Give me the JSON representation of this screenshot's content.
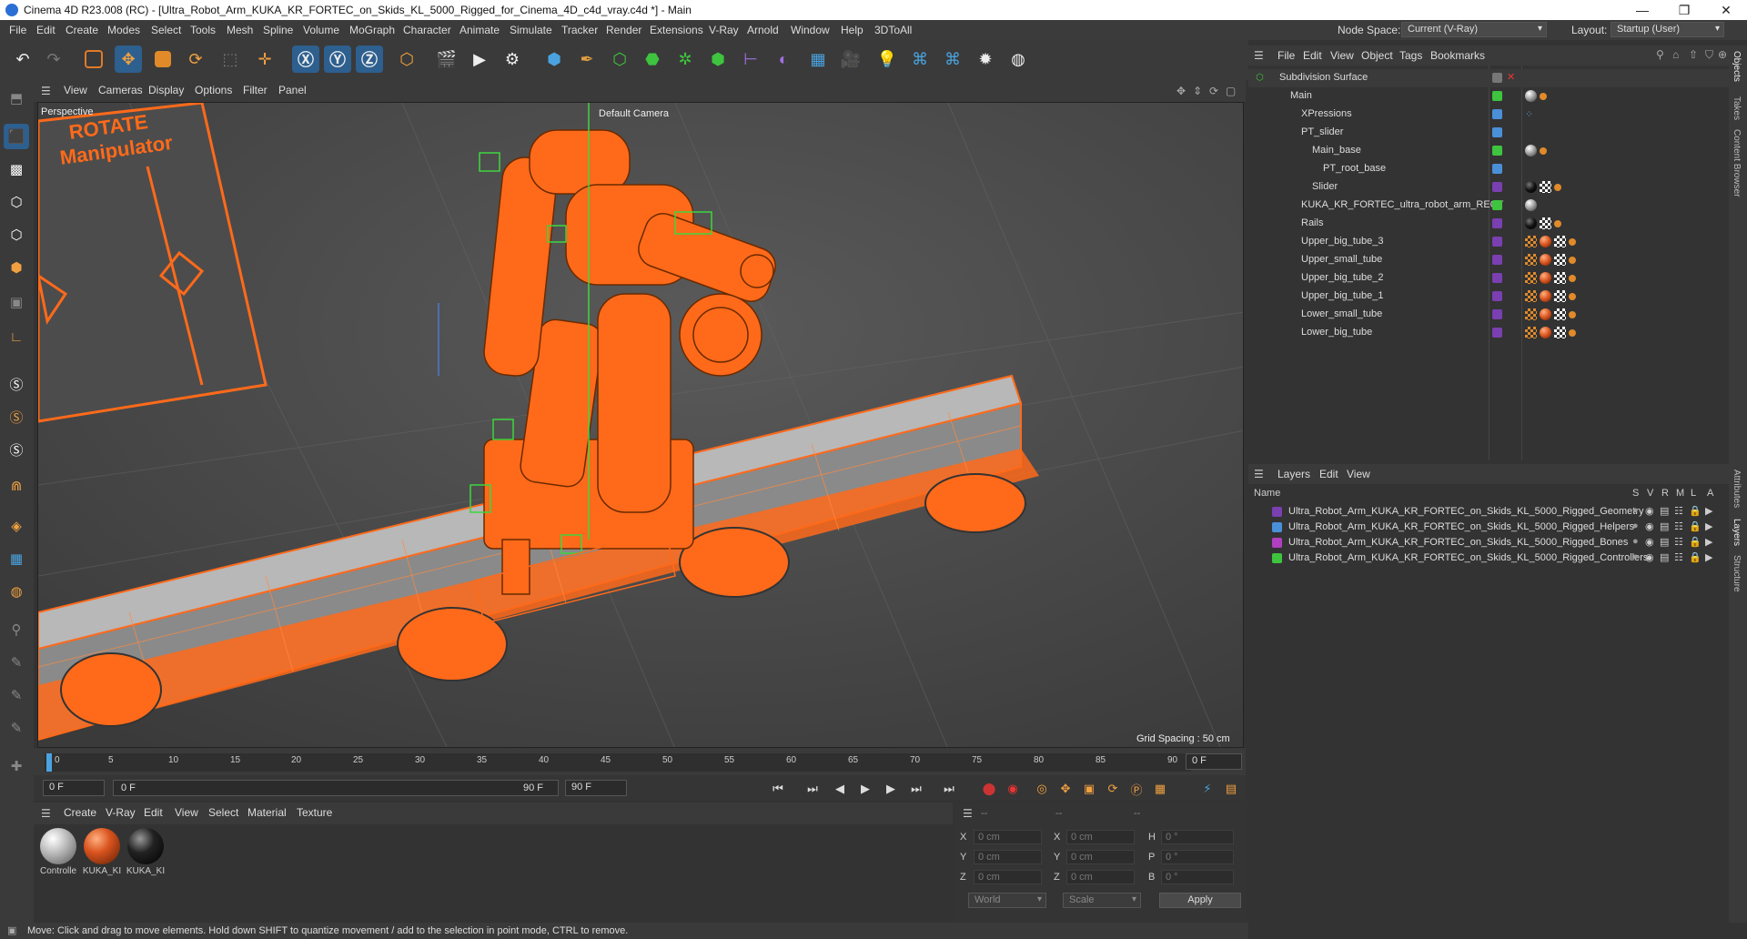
{
  "window": {
    "title": "Cinema 4D R23.008 (RC) - [Ultra_Robot_Arm_KUKA_KR_FORTEC_on_Skids_KL_5000_Rigged_for_Cinema_4D_c4d_vray.c4d *] - Main",
    "minimize": "—",
    "maximize": "❐",
    "close": "✕"
  },
  "menubar": {
    "items": [
      "File",
      "Edit",
      "Create",
      "Modes",
      "Select",
      "Tools",
      "Mesh",
      "Spline",
      "Volume",
      "MoGraph",
      "Character",
      "Animate",
      "Simulate",
      "Tracker",
      "Render",
      "Extensions",
      "V-Ray",
      "Arnold",
      "Window",
      "Help",
      "3DToAll"
    ],
    "node_space_label": "Node Space:",
    "node_space_value": "Current (V-Ray)",
    "layout_label": "Layout:",
    "layout_value": "Startup (User)"
  },
  "viewport_menu": [
    "View",
    "Cameras",
    "Display",
    "Options",
    "Filter",
    "Panel"
  ],
  "viewport": {
    "view_name": "Perspective",
    "camera": "Default Camera",
    "grid_spacing": "Grid Spacing : 50 cm",
    "overlay_text1": "ROTATE",
    "overlay_text2": "Manipulator"
  },
  "timeline": {
    "ticks": [
      "0",
      "5",
      "10",
      "15",
      "20",
      "25",
      "30",
      "35",
      "40",
      "45",
      "50",
      "55",
      "60",
      "65",
      "70",
      "75",
      "80",
      "85",
      "90"
    ],
    "current_frame_right": "0 F",
    "start_field": "0 F",
    "range_field": "0 F",
    "end_field": "90 F",
    "max_field": "90 F"
  },
  "material_menu": [
    "Create",
    "V-Ray",
    "Edit",
    "View",
    "Select",
    "Material",
    "Texture"
  ],
  "materials": [
    {
      "name": "Controlle",
      "color": "#bdbdbd"
    },
    {
      "name": "KUKA_KI",
      "color": "#d9531e"
    },
    {
      "name": "KUKA_KI",
      "color": "#222222"
    }
  ],
  "coords": {
    "header1": "--",
    "header2": "--",
    "header3": "--",
    "rows": [
      {
        "a": "X",
        "av": "0 cm",
        "b": "X",
        "bv": "0 cm",
        "c": "H",
        "cv": "0 °"
      },
      {
        "a": "Y",
        "av": "0 cm",
        "b": "Y",
        "bv": "0 cm",
        "c": "P",
        "cv": "0 °"
      },
      {
        "a": "Z",
        "av": "0 cm",
        "b": "Z",
        "bv": "0 cm",
        "c": "B",
        "cv": "0 °"
      }
    ],
    "world": "World",
    "scale": "Scale",
    "apply": "Apply"
  },
  "status": "Move: Click and drag to move elements. Hold down SHIFT to quantize movement / add to the selection in point mode, CTRL to remove.",
  "object_manager": {
    "menu": [
      "File",
      "Edit",
      "View",
      "Object",
      "Tags",
      "Bookmarks"
    ],
    "objects": [
      {
        "name": "Subdivision Surface",
        "indent": 0,
        "color": "#888"
      },
      {
        "name": "Main",
        "indent": 1,
        "color": "#3ec43e"
      },
      {
        "name": "XPressions",
        "indent": 2,
        "color": "#4a90d9"
      },
      {
        "name": "PT_slider",
        "indent": 2,
        "color": "#4a90d9"
      },
      {
        "name": "Main_base",
        "indent": 3,
        "color": "#3ec43e"
      },
      {
        "name": "PT_root_base",
        "indent": 4,
        "color": "#4a90d9"
      },
      {
        "name": "Slider",
        "indent": 3,
        "color": "#7a3fb0"
      },
      {
        "name": "KUKA_KR_FORTEC_ultra_robot_arm_RECT",
        "indent": 2,
        "color": "#3ec43e"
      },
      {
        "name": "Rails",
        "indent": 2,
        "color": "#7a3fb0"
      },
      {
        "name": "Upper_big_tube_3",
        "indent": 2,
        "color": "#7a3fb0"
      },
      {
        "name": "Upper_small_tube",
        "indent": 2,
        "color": "#7a3fb0"
      },
      {
        "name": "Upper_big_tube_2",
        "indent": 2,
        "color": "#7a3fb0"
      },
      {
        "name": "Upper_big_tube_1",
        "indent": 2,
        "color": "#7a3fb0"
      },
      {
        "name": "Lower_small_tube",
        "indent": 2,
        "color": "#7a3fb0"
      },
      {
        "name": "Lower_big_tube",
        "indent": 2,
        "color": "#7a3fb0"
      }
    ]
  },
  "layers": {
    "menu": [
      "Layers",
      "Edit",
      "View"
    ],
    "header_name": "Name",
    "header_cols": [
      "S",
      "V",
      "R",
      "M",
      "L",
      "A"
    ],
    "rows": [
      {
        "name": "Ultra_Robot_Arm_KUKA_KR_FORTEC_on_Skids_KL_5000_Rigged_Geometry",
        "color": "#7a3fb0"
      },
      {
        "name": "Ultra_Robot_Arm_KUKA_KR_FORTEC_on_Skids_KL_5000_Rigged_Helpers",
        "color": "#4a90d9"
      },
      {
        "name": "Ultra_Robot_Arm_KUKA_KR_FORTEC_on_Skids_KL_5000_Rigged_Bones",
        "color": "#b040c0"
      },
      {
        "name": "Ultra_Robot_Arm_KUKA_KR_FORTEC_on_Skids_KL_5000_Rigged_Controllers",
        "color": "#3ec43e"
      }
    ]
  },
  "side_tabs": [
    "Objects",
    "Takes",
    "Content Browser",
    "Attributes",
    "Layers",
    "Structure"
  ]
}
